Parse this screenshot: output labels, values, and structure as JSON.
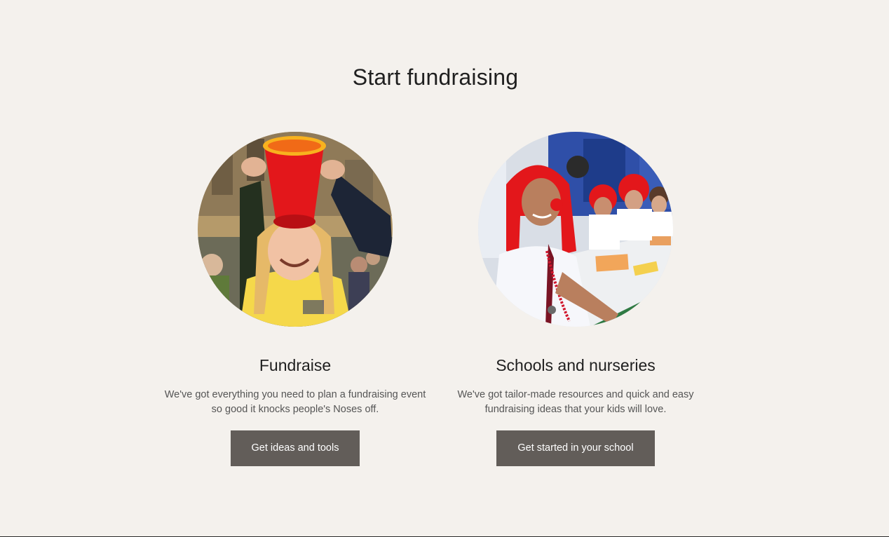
{
  "section": {
    "title": "Start fundraising"
  },
  "cards": [
    {
      "title": "Fundraise",
      "text": "We've got everything you need to plan a fundraising event so good it knocks people's Noses off.",
      "button_label": "Get ideas and tools",
      "image_alt": "Girl in yellow sweatshirt laughing as a red bucket is tipped over her head"
    },
    {
      "title": "Schools and nurseries",
      "text": "We've got tailor-made resources and quick and easy fundraising ideas that your kids will love.",
      "button_label": "Get started in your school",
      "image_alt": "Students in red wigs and red noses sitting at a classroom table"
    }
  ],
  "colors": {
    "background": "#f4f1ed",
    "button": "#625d59",
    "accent_red": "#e3171b"
  }
}
